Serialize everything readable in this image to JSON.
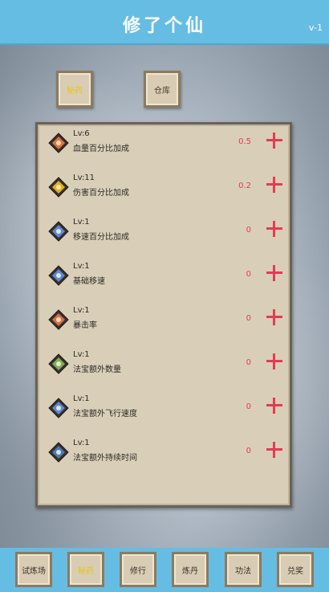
{
  "header": {
    "title": "修了个仙",
    "version": "v-1"
  },
  "tabs": [
    {
      "label": "秘药",
      "active": true
    },
    {
      "label": "仓库",
      "active": false
    }
  ],
  "attributes": [
    {
      "level": "Lv:6",
      "name": "血量百分比加成",
      "value": "0.5",
      "icon": "heart-shield-icon",
      "color": "#e0733d"
    },
    {
      "level": "Lv:11",
      "name": "伤害百分比加成",
      "value": "0.2",
      "icon": "fire-slash-icon",
      "color": "#e0b020"
    },
    {
      "level": "Lv:1",
      "name": "移速百分比加成",
      "value": "0",
      "icon": "diamond-star-icon",
      "color": "#5a8ad8"
    },
    {
      "level": "Lv:1",
      "name": "基础移速",
      "value": "0",
      "icon": "diamond-star-icon",
      "color": "#5a8ad8"
    },
    {
      "level": "Lv:1",
      "name": "暴击率",
      "value": "0",
      "icon": "crit-rune-icon",
      "color": "#d4704a"
    },
    {
      "level": "Lv:1",
      "name": "法宝额外数量",
      "value": "0",
      "icon": "leaf-gem-icon",
      "color": "#7cae5c"
    },
    {
      "level": "Lv:1",
      "name": "法宝额外飞行速度",
      "value": "0",
      "icon": "diamond-star-icon",
      "color": "#5a8ad8"
    },
    {
      "level": "Lv:1",
      "name": "法宝额外持续时间",
      "value": "0",
      "icon": "rune-staff-icon",
      "color": "#4a7ab8"
    }
  ],
  "bottom_nav": [
    {
      "label": "试炼场",
      "active": false
    },
    {
      "label": "秘药",
      "active": true
    },
    {
      "label": "修行",
      "active": false
    },
    {
      "label": "炼丹",
      "active": false
    },
    {
      "label": "功法",
      "active": false
    },
    {
      "label": "兑奖",
      "active": false
    }
  ]
}
